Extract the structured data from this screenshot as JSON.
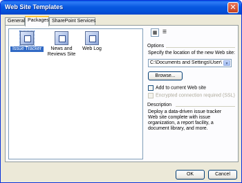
{
  "window": {
    "title": "Web Site Templates",
    "close_glyph": "✕"
  },
  "tabs": [
    {
      "label": "General"
    },
    {
      "label": "Packages"
    },
    {
      "label": "SharePoint Services"
    }
  ],
  "templates": [
    {
      "label": "Issue Tracker",
      "icon": "issue-tracker-icon",
      "selected": true
    },
    {
      "label": "News and Reviews Site",
      "icon": "news-reviews-icon",
      "selected": false
    },
    {
      "label": "Web Log",
      "icon": "web-log-icon",
      "selected": false
    }
  ],
  "view_buttons": {
    "large_icons": "▦",
    "details": "☰"
  },
  "options": {
    "heading": "Options",
    "location_label": "Specify the location of the new Web site:",
    "location_value": "C:\\Documents and Settings\\User\\My",
    "browse_label": "Browse...",
    "add_to_current_label": "Add to current Web site",
    "add_to_current_checked": false,
    "encrypted_label": "Encrypted connection required (SSL)",
    "encrypted_checked": false,
    "encrypted_enabled": false
  },
  "description": {
    "heading": "Description",
    "text": "Deploy a data-driven issue tracker Web site complete with issue organization, a report facility, a document library, and more."
  },
  "footer": {
    "ok_label": "OK",
    "cancel_label": "Cancel"
  },
  "colors": {
    "title_bar": "#0858e0",
    "selection": "#316ac5",
    "tab_highlight": "#ffc83c"
  }
}
